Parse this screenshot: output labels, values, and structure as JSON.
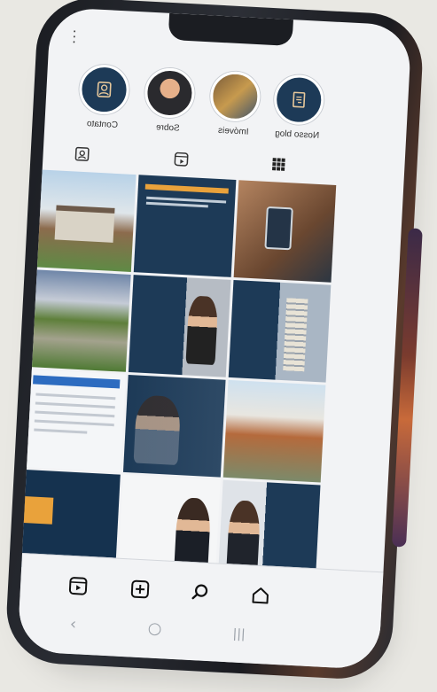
{
  "highlights": [
    {
      "label": "Nosso blog",
      "icon": "blog-icon"
    },
    {
      "label": "Imóveis",
      "icon": "property-photo"
    },
    {
      "label": "Sobre",
      "icon": "profile-photo"
    },
    {
      "label": "Contato",
      "icon": "contact-icon"
    }
  ],
  "tabs": [
    "grid-icon",
    "reels-icon",
    "tagged-icon"
  ],
  "bottom_nav": [
    "home-icon",
    "search-icon",
    "create-icon",
    "reels-icon"
  ],
  "system_nav": {
    "back": "‹",
    "home": "○",
    "recents": "|||"
  },
  "colors": {
    "brand_navy": "#1d3a57",
    "accent_orange": "#e9a23b",
    "background": "#f2f3f5"
  }
}
